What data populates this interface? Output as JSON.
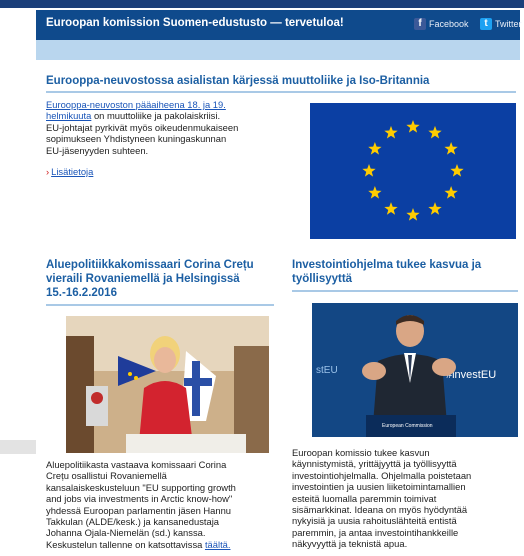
{
  "header": {
    "title": "Euroopan komission Suomen-edustusto — tervetuloa!",
    "facebook": "Facebook",
    "twitter": "Twitter"
  },
  "main_article": {
    "headline": "Eurooppa-neuvostossa asialistan kärjessä muuttoliike ja Iso-Britannia",
    "link_line1": "Eurooppa-neuvoston pääaiheena 18. ja 19.",
    "link_line2": "helmikuuta",
    "text_line1": " on muuttoliike ja pakolaiskriisi.",
    "text_line2": "EU-johtajat pyrkivät myös oikeudenmukaiseen",
    "text_line3": "sopimukseen Yhdistyneen kuningaskunnan",
    "text_line4": "EU-jäsenyyden suhteen.",
    "more": "Lisätietoja"
  },
  "article_left": {
    "headline_lines": [
      "Aluepolitiikkakomissaari Corina Crețu",
      "vieraili Rovaniemellä ja Helsingissä",
      "15.-16.2.2016"
    ],
    "body_lines": [
      "Aluepolitiikasta vastaava komissaari Corina",
      "Crețu osallistui Rovaniemellä",
      "kansalaiskeskusteluun \"EU supporting growth",
      "and jobs via investments in Arctic know-how\"",
      "yhdessä Euroopan parlamentin jäsen Hannu",
      "Takkulan (ALDE/kesk.) ja kansanedustaja",
      "Johanna Ojala-Niemelän (sd.) kanssa."
    ],
    "last_line_text": "Keskustelun tallenne on katsottavissa ",
    "last_line_link": "täältä."
  },
  "article_right": {
    "headline_lines": [
      "Investointiohjelma tukee kasvua ja",
      "työllisyyttä"
    ],
    "photo_text": "#investEU",
    "photo_panel": "European Commission",
    "body_lines": [
      "Euroopan komissio tukee kasvun",
      "käynnistymistä, yrittäjyyttä ja työllisyyttä",
      "investointiohjelmalla. Ohjelmalla poistetaan",
      "investointien ja uusien liiketoimintamallien",
      "esteitä luomalla paremmin toimivat",
      "sisämarkkinat. Ideana on myös hyödyntää",
      "nykyisiä ja uusia rahoituslähteitä entistä",
      "paremmin, ja antaa investointihankkeille",
      "näkyvyyttä ja teknistä apua."
    ]
  },
  "colors": {
    "header_bg": "#0f4a8c",
    "subbar": "#b9d6ee",
    "headline": "#1c5fa3",
    "eu_blue": "#0b3fa3",
    "eu_star": "#ffcc00"
  }
}
